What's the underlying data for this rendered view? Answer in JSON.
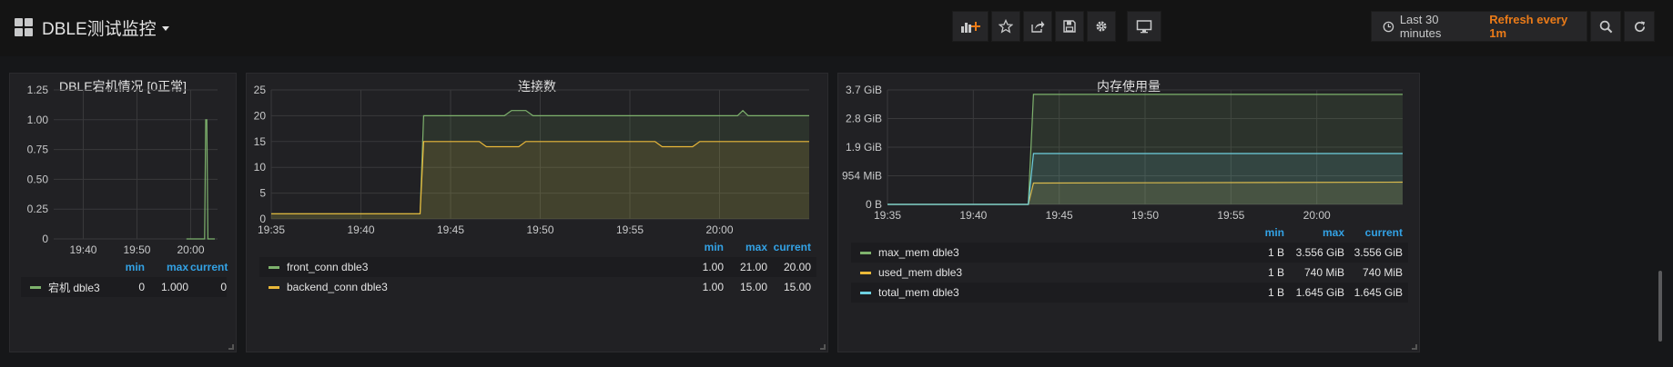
{
  "dashboard": {
    "title": "DBLE测试监控"
  },
  "toolbar": {
    "buttons": [
      {
        "name": "add-panel-button",
        "icon": "add-panel-icon"
      },
      {
        "name": "star-button",
        "icon": "star-icon"
      },
      {
        "name": "share-button",
        "icon": "share-icon"
      },
      {
        "name": "save-button",
        "icon": "save-icon"
      },
      {
        "name": "settings-button",
        "icon": "gear-icon"
      },
      {
        "name": "tv-mode-button",
        "icon": "monitor-icon"
      },
      {
        "name": "zoom-out-button",
        "icon": "search-icon"
      },
      {
        "name": "refresh-button",
        "icon": "refresh-icon"
      }
    ],
    "time_range": "Last 30 minutes",
    "refresh_label": "Refresh every 1m"
  },
  "panels": [
    {
      "title": "DBLE宕机情况 [0正常]",
      "legend": {
        "headers": [
          "min",
          "max",
          "current"
        ],
        "rows": [
          {
            "name": "宕机 dble3",
            "color": "#7eb26d",
            "min": "0",
            "max": "1.000",
            "current": "0"
          }
        ]
      }
    },
    {
      "title": "连接数",
      "legend": {
        "headers": [
          "min",
          "max",
          "current"
        ],
        "rows": [
          {
            "name": "front_conn dble3",
            "color": "#7eb26d",
            "min": "1.00",
            "max": "21.00",
            "current": "20.00"
          },
          {
            "name": "backend_conn dble3",
            "color": "#eab839",
            "min": "1.00",
            "max": "15.00",
            "current": "15.00"
          }
        ]
      }
    },
    {
      "title": "内存使用量",
      "legend": {
        "headers": [
          "min",
          "max",
          "current"
        ],
        "rows": [
          {
            "name": "max_mem dble3",
            "color": "#7eb26d",
            "min": "1 B",
            "max": "3.556 GiB",
            "current": "3.556 GiB"
          },
          {
            "name": "used_mem dble3",
            "color": "#eab839",
            "min": "1 B",
            "max": "740 MiB",
            "current": "740 MiB"
          },
          {
            "name": "total_mem dble3",
            "color": "#6ed0e0",
            "min": "1 B",
            "max": "1.645 GiB",
            "current": "1.645 GiB"
          }
        ]
      }
    }
  ],
  "chart_data": [
    {
      "type": "line",
      "title": "DBLE宕机情况 [0正常]",
      "x_ticks": [
        "19:40",
        "19:50",
        "20:00"
      ],
      "y_ticks": [
        "0",
        "0.25",
        "0.50",
        "0.75",
        "1.00",
        "1.25"
      ],
      "ylim": [
        0,
        1.25
      ],
      "xlim_minutes": [
        34.5,
        65
      ],
      "series": [
        {
          "name": "宕机 dble3",
          "color": "#7eb26d",
          "x": [
            59.2,
            62.4,
            62.6,
            62.8,
            63.0,
            63.2,
            64.5
          ],
          "y": [
            0,
            0,
            0,
            1,
            1,
            0,
            0
          ]
        }
      ],
      "grid": true
    },
    {
      "type": "area",
      "title": "连接数",
      "x_ticks": [
        "19:35",
        "19:40",
        "19:45",
        "19:50",
        "19:55",
        "20:00"
      ],
      "y_ticks": [
        "0",
        "5",
        "10",
        "15",
        "20",
        "25"
      ],
      "ylim": [
        0,
        25
      ],
      "xlim_minutes": [
        35,
        65
      ],
      "series": [
        {
          "name": "front_conn dble3",
          "color": "#7eb26d",
          "x": [
            35,
            37.3,
            38.3,
            43.3,
            43.5,
            48,
            48.4,
            49.2,
            49.6,
            61,
            61.3,
            61.6,
            65
          ],
          "y": [
            1,
            1,
            1,
            1,
            20,
            20,
            21,
            21,
            20,
            20,
            21,
            20,
            20
          ]
        },
        {
          "name": "backend_conn dble3",
          "color": "#eab839",
          "x": [
            35,
            37.3,
            38.3,
            43.3,
            43.5,
            46.6,
            47,
            48.8,
            49.2,
            56.4,
            56.8,
            58.5,
            58.9,
            65
          ],
          "y": [
            1,
            1,
            1,
            1,
            15,
            15,
            14,
            14,
            15,
            15,
            14,
            14,
            15,
            15
          ]
        }
      ],
      "grid": true
    },
    {
      "type": "area",
      "title": "内存使用量",
      "x_ticks": [
        "19:35",
        "19:40",
        "19:45",
        "19:50",
        "19:55",
        "20:00"
      ],
      "y_ticks": [
        "0 B",
        "954 MiB",
        "1.9 GiB",
        "2.8 GiB",
        "3.7 GiB"
      ],
      "ylim_gib": [
        0,
        3.7
      ],
      "xlim_minutes": [
        35,
        65
      ],
      "series": [
        {
          "name": "max_mem dble3",
          "color": "#7eb26d",
          "x": [
            35,
            37.1,
            38.0,
            43.2,
            43.5,
            65
          ],
          "y_gib": [
            0,
            0,
            0,
            0,
            3.556,
            3.556
          ]
        },
        {
          "name": "used_mem dble3",
          "color": "#eab839",
          "x": [
            35,
            37.1,
            38.0,
            43.2,
            43.5,
            50,
            65
          ],
          "y_gib": [
            0,
            0,
            0,
            0,
            0.69,
            0.7,
            0.72
          ]
        },
        {
          "name": "total_mem dble3",
          "color": "#6ed0e0",
          "x": [
            35,
            37.1,
            38.0,
            43.2,
            43.5,
            65
          ],
          "y_gib": [
            0,
            0,
            0,
            0,
            1.645,
            1.645
          ]
        }
      ],
      "grid": true
    }
  ]
}
